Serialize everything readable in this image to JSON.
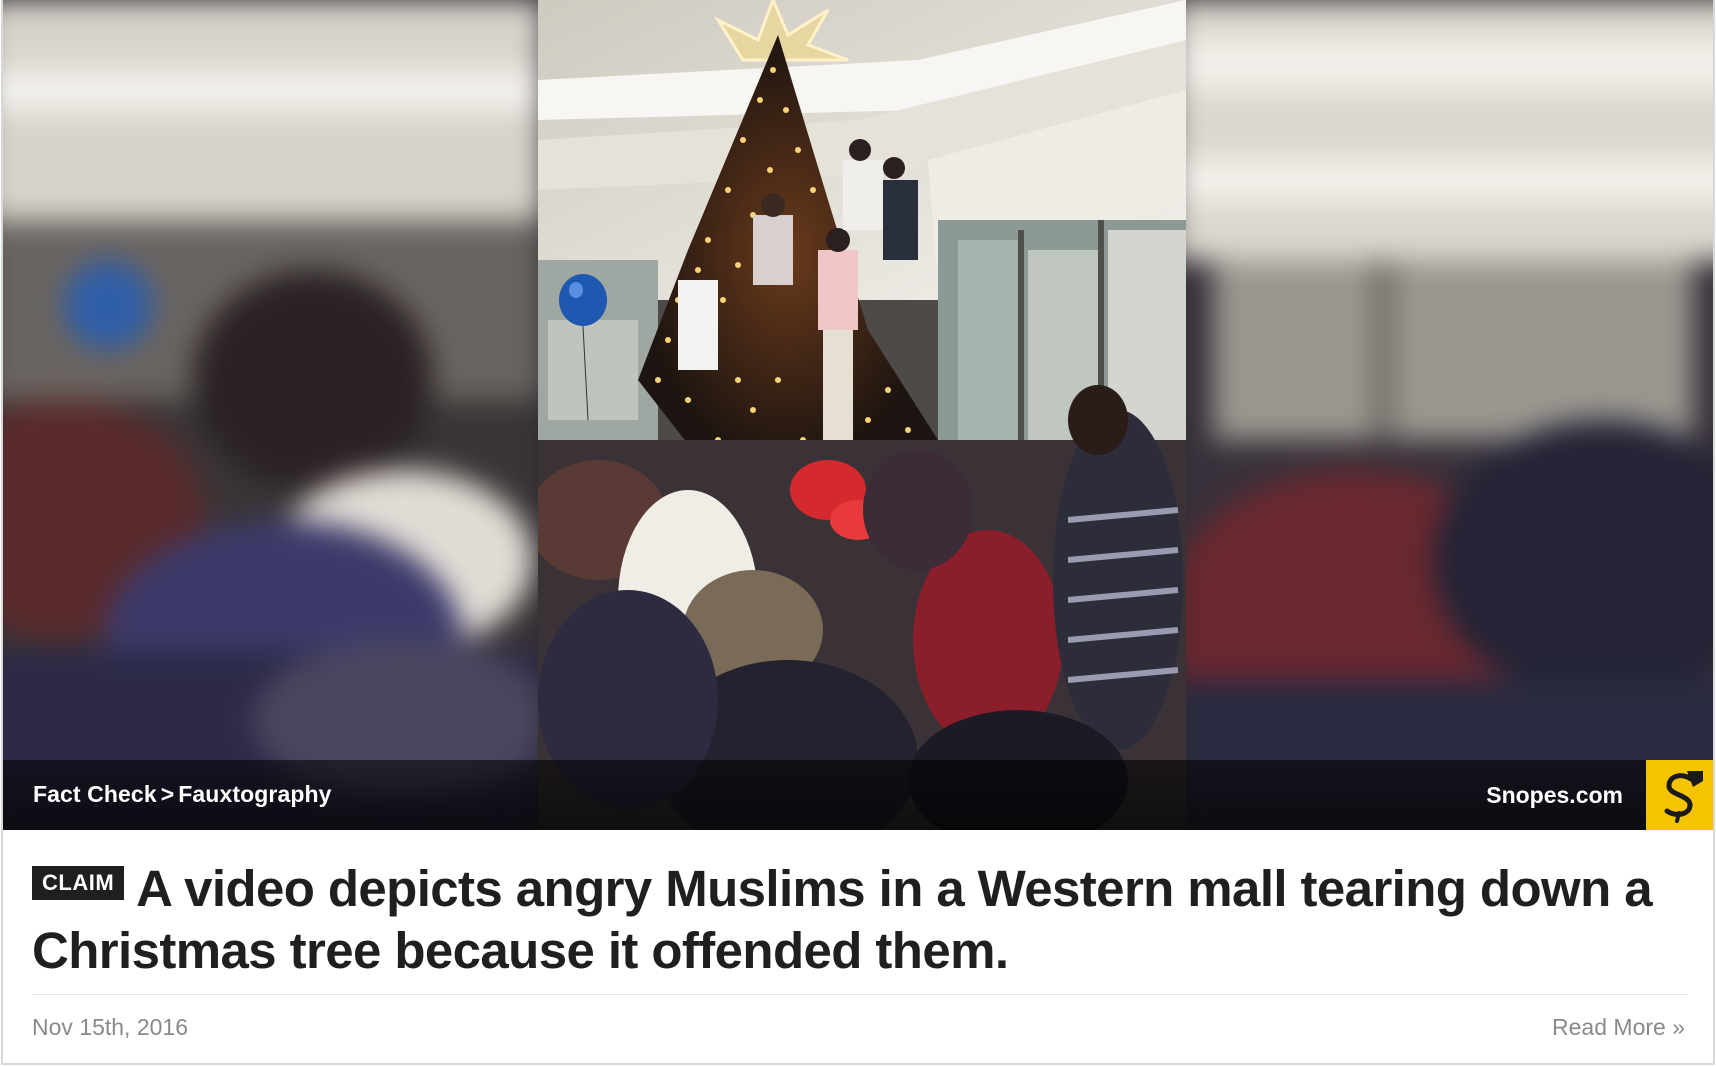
{
  "hero": {
    "image_alt": "Crowd in a mall surrounding a lit Christmas tree",
    "breadcrumb": {
      "section": "Fact Check",
      "separator": ">",
      "category": "Fauxtography"
    },
    "site_name": "Snopes.com",
    "logo_icon": "snopes-s-logo-icon",
    "logo_color": "#f5c400"
  },
  "article": {
    "badge": "CLAIM",
    "headline": "A video depicts angry Muslims in a Western mall tearing down a Christmas tree because it offended them.",
    "date": "Nov 15th, 2016",
    "read_more": "Read More »"
  }
}
